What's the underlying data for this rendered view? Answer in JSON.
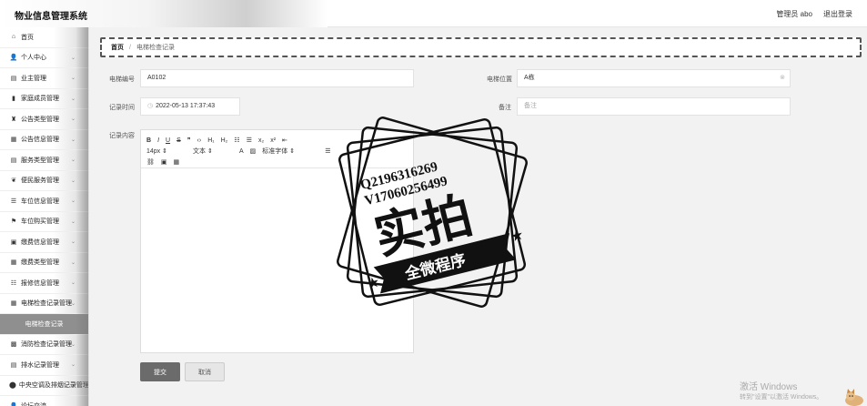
{
  "header": {
    "title": "物业信息管理系统",
    "user": "管理员 abo",
    "logout": "退出登录"
  },
  "sidebar": {
    "items": [
      {
        "label": "首页",
        "icon": "home-icon",
        "glyph": "⌂",
        "chev": false
      },
      {
        "label": "个人中心",
        "icon": "user-icon",
        "glyph": "👤",
        "chev": true
      },
      {
        "label": "业主管理",
        "icon": "table-icon",
        "glyph": "▤",
        "chev": true
      },
      {
        "label": "家庭成员管理",
        "icon": "bar-chart-icon",
        "glyph": "▮",
        "chev": true
      },
      {
        "label": "公告类型管理",
        "icon": "trophy-icon",
        "glyph": "♜",
        "chev": true
      },
      {
        "label": "公告信息管理",
        "icon": "grid-icon",
        "glyph": "▦",
        "chev": true
      },
      {
        "label": "服务类型管理",
        "icon": "table-icon",
        "glyph": "▤",
        "chev": true
      },
      {
        "label": "便民服务管理",
        "icon": "leaf-icon",
        "glyph": "❦",
        "chev": true
      },
      {
        "label": "车位信息管理",
        "icon": "list-icon",
        "glyph": "☰",
        "chev": true
      },
      {
        "label": "车位购买管理",
        "icon": "flag-icon",
        "glyph": "⚑",
        "chev": true
      },
      {
        "label": "缴费信息管理",
        "icon": "film-icon",
        "glyph": "▣",
        "chev": true
      },
      {
        "label": "缴费类型管理",
        "icon": "grid-icon",
        "glyph": "▦",
        "chev": true
      },
      {
        "label": "报修信息管理",
        "icon": "sliders-icon",
        "glyph": "☷",
        "chev": true
      },
      {
        "label": "电梯检查记录管理",
        "icon": "grid-icon",
        "glyph": "▦",
        "chev": true
      },
      {
        "label": "电梯检查记录",
        "icon": "",
        "glyph": "",
        "chev": false,
        "sub": true
      },
      {
        "label": "消防检查记录管理",
        "icon": "grid-dots-icon",
        "glyph": "▩",
        "chev": true
      },
      {
        "label": "排水记录管理",
        "icon": "table-icon",
        "glyph": "▤",
        "chev": true
      },
      {
        "label": "中央空调及排烟记录管理",
        "icon": "map-marker-icon",
        "glyph": "⬤",
        "chev": false
      },
      {
        "label": "论坛交流",
        "icon": "user-icon",
        "glyph": "👤",
        "chev": false
      }
    ]
  },
  "breadcrumb": {
    "home": "首页",
    "separator": "/",
    "current": "电梯检查记录"
  },
  "form": {
    "elevator_no_label": "电梯编号",
    "elevator_no_value": "A0102",
    "location_label": "电梯位置",
    "location_value": "A栋",
    "time_label": "记录时间",
    "time_value": "2022-05-13 17:37:43",
    "remark_label": "备注",
    "remark_placeholder": "备注",
    "content_label": "记录内容"
  },
  "editor": {
    "font_size": "14px",
    "font_type": "文本",
    "font_family": "标准字体"
  },
  "buttons": {
    "submit": "提交",
    "cancel": "取消"
  },
  "watermark": {
    "qq": "Q2196316269",
    "vx": "V17060256499",
    "main": "实拍",
    "banner": "全微程序"
  },
  "windows_activation": {
    "line1": "激活 Windows",
    "line2": "转到\"设置\"以激活 Windows。"
  }
}
